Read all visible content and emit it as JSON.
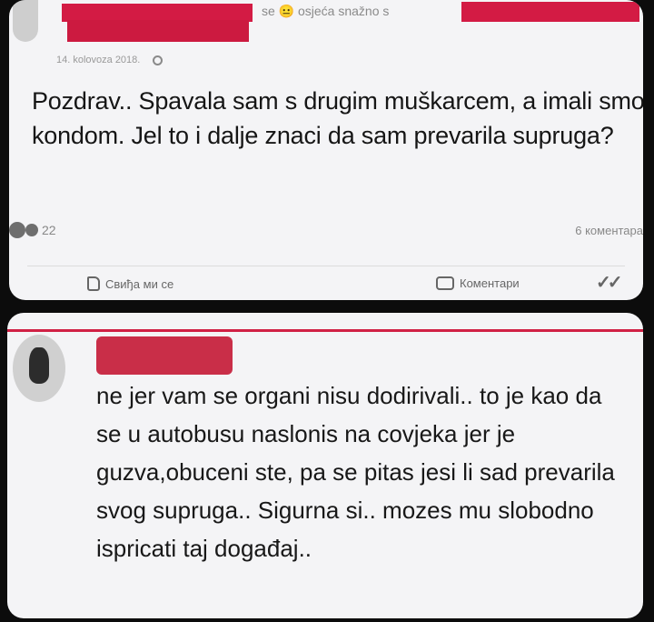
{
  "post": {
    "header_feeling": "se 😐 osjeća snažno s",
    "date": "14. kolovoza 2018.",
    "body": "Pozdrav.. Spavala sam s drugim muškarcem, a imali smo kondom. Jel to i dalje znaci da sam prevarila supruga?",
    "reaction_count": "22",
    "comment_count": "6 коментара",
    "like_label": "Свиђа ми се",
    "comment_label": "Коментари",
    "colors": {
      "redaction": "#d31b44",
      "card": "#f4f4f6",
      "background": "#0c0c0c"
    }
  },
  "comment": {
    "body": "ne jer vam se organi nisu dodirivali.. to je kao da se u autobusu naslonis na covjeka jer je guzva,obuceni ste, pa se pitas jesi li sad prevarila svog supruga.. Sigurna si.. mozes mu slobodno ispricati taj događaj.."
  }
}
